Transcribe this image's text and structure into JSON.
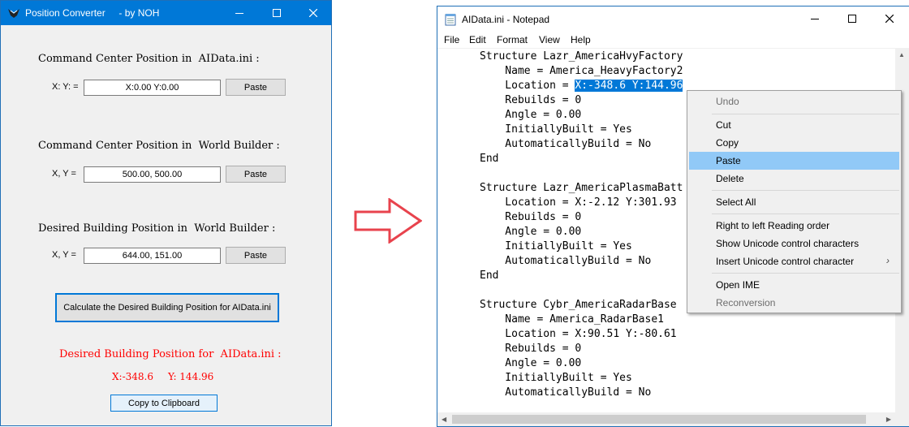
{
  "converter": {
    "title": "Position Converter     - by NOH",
    "section1_label": "Command Center Position in  AIData.ini :",
    "section1_xy_label": "X: Y: =",
    "section1_value": "X:0.00 Y:0.00",
    "section2_label": "Command Center Position in  World Builder :",
    "section2_xy_label": "X, Y =",
    "section2_value": "500.00, 500.00",
    "section3_label": "Desired Building Position in  World Builder :",
    "section3_xy_label": "X, Y =",
    "section3_value": "644.00, 151.00",
    "paste_label": "Paste",
    "calc_button": "Calculate the Desired Building Position for  AIData.ini",
    "result_title": "Desired Building Position for  AIData.ini :",
    "result_x": "X:-348.6",
    "result_y": "Y: 144.96",
    "copy_button": "Copy to Clipboard"
  },
  "notepad": {
    "title": "AIData.ini - Notepad",
    "menu": [
      "File",
      "Edit",
      "Format",
      "View",
      "Help"
    ],
    "lines": [
      "Structure Lazr_AmericaHvyFactory",
      "    Name = America_HeavyFactory2",
      "    Location = ",
      "    Rebuilds = 0",
      "    Angle = 0.00",
      "    InitiallyBuilt = Yes",
      "    AutomaticallyBuild = No",
      "End",
      "",
      "Structure Lazr_AmericaPlasmaBatt",
      "    Location = X:-2.12 Y:301.93",
      "    Rebuilds = 0",
      "    Angle = 0.00",
      "    InitiallyBuilt = Yes",
      "    AutomaticallyBuild = No",
      "End",
      "",
      "Structure Cybr_AmericaRadarBase",
      "    Name = America_RadarBase1",
      "    Location = X:90.51 Y:-80.61",
      "    Rebuilds = 0",
      "    Angle = 0.00",
      "    InitiallyBuilt = Yes",
      "    AutomaticallyBuild = No"
    ],
    "selected_text": "X:-348.6 Y:144.96"
  },
  "context_menu": {
    "items": [
      "Undo",
      "Cut",
      "Copy",
      "Paste",
      "Delete",
      "Select All",
      "Right to left Reading order",
      "Show Unicode control characters",
      "Insert Unicode control character",
      "Open IME",
      "Reconversion"
    ],
    "highlighted": "Paste"
  },
  "colors": {
    "accent": "#0078d7",
    "result_text": "#ff0000",
    "arrow": "#e8434d",
    "menu_highlight": "#91c9f7"
  }
}
